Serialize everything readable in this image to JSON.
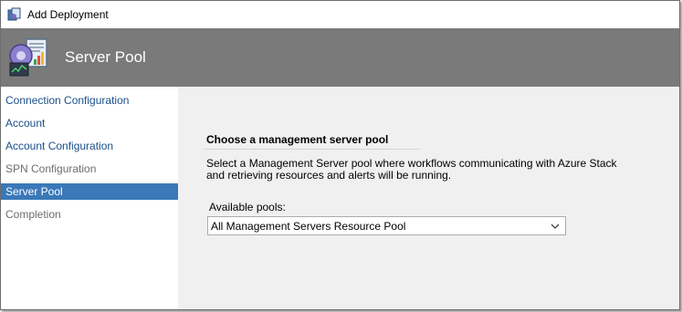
{
  "window": {
    "title": "Add Deployment",
    "icon": "deployment-wizard-icon"
  },
  "banner": {
    "title": "Server Pool",
    "icon": "server-pool-wizard-icon"
  },
  "nav": {
    "items": [
      {
        "label": "Connection Configuration",
        "state": "link"
      },
      {
        "label": "Account",
        "state": "link"
      },
      {
        "label": "Account Configuration",
        "state": "link"
      },
      {
        "label": "SPN Configuration",
        "state": "disabled"
      },
      {
        "label": "Server Pool",
        "state": "selected"
      },
      {
        "label": "Completion",
        "state": "disabled"
      }
    ]
  },
  "content": {
    "section_title": "Choose a management server pool",
    "description": "Select a Management Server pool where workflows communicating with Azure Stack and retrieving resources and alerts will be running.",
    "pools_label": "Available pools:",
    "pool_selected": "All Management Servers Resource Pool"
  },
  "colors": {
    "banner": "#7a7a7a",
    "nav_link": "#1a4f8a",
    "nav_disabled": "#6d6d6d",
    "nav_selected_bg": "#3a78b8",
    "content_bg": "#f0f0f0"
  }
}
